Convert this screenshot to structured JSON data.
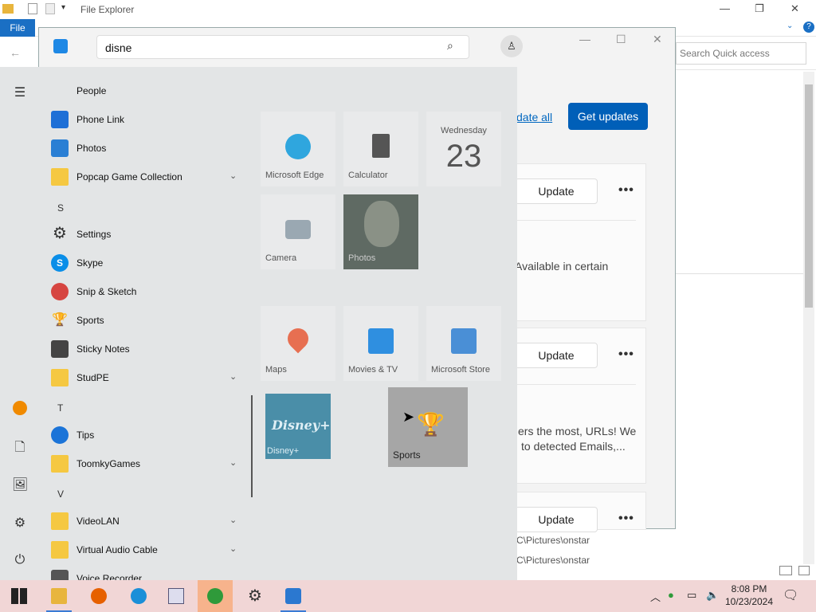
{
  "file_explorer": {
    "title": "File Explorer",
    "file_tab": "File",
    "search_placeholder": "Search Quick access",
    "path1": "PC\\Pictures\\onstar",
    "path2": "PC\\Pictures\\onstar"
  },
  "store": {
    "search_value": "disne",
    "update_all": "date all",
    "get_updates": "Get updates",
    "update_label": "Update",
    "more_label": "•••",
    "card1_text": "Available in certain",
    "card2_line1": "ers the most, URLs! We",
    "card2_line2": "to detected Emails,..."
  },
  "start_menu": {
    "apps": [
      {
        "label": "People"
      },
      {
        "label": "Phone Link"
      },
      {
        "label": "Photos"
      },
      {
        "label": "Popcap Game Collection"
      },
      {
        "label": "Settings"
      },
      {
        "label": "Skype"
      },
      {
        "label": "Snip & Sketch"
      },
      {
        "label": "Sports"
      },
      {
        "label": "Sticky Notes"
      },
      {
        "label": "StudPE"
      },
      {
        "label": "Tips"
      },
      {
        "label": "ToomkyGames"
      },
      {
        "label": "VideoLAN"
      },
      {
        "label": "Virtual Audio Cable"
      },
      {
        "label": "Voice Recorder"
      }
    ],
    "letters": {
      "s": "S",
      "t": "T",
      "v": "V"
    },
    "tiles": {
      "edge": "Microsoft Edge",
      "calculator": "Calculator",
      "calendar_day": "Wednesday",
      "calendar_date": "23",
      "camera": "Camera",
      "photos": "Photos",
      "maps": "Maps",
      "movies": "Movies & TV",
      "store": "Microsoft Store",
      "disney": "Disney+",
      "sports": "Sports"
    }
  },
  "taskbar": {
    "time": "8:08 PM",
    "date": "10/23/2024"
  },
  "colors": {
    "accent": "#005fb8",
    "file_tab": "#1a6fc4",
    "taskbar": "#f1d6d6",
    "start_bg": "#e3e5e6"
  }
}
